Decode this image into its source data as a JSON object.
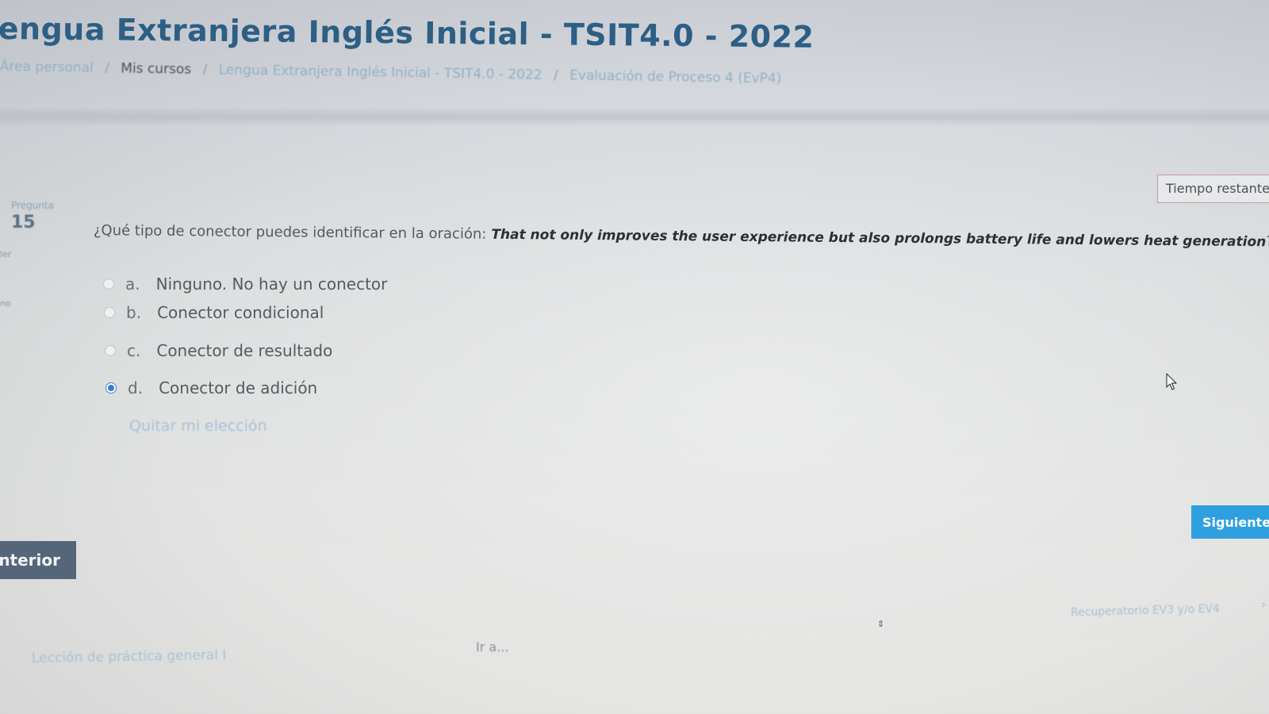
{
  "header": {
    "title": "engua Extranjera Inglés Inicial - TSIT4.0 - 2022",
    "breadcrumb": [
      {
        "label": "Área personal",
        "current": false
      },
      {
        "label": "Mis cursos",
        "current": true
      },
      {
        "label": "Lengua Extranjera Inglés Inicial - TSIT4.0 - 2022",
        "current": false
      },
      {
        "label": "Evaluación de Proceso 4 (EvP4)",
        "current": false
      }
    ],
    "separator": "/"
  },
  "timer": {
    "label": "Tiempo restante"
  },
  "question_info": {
    "label": "Pregunta",
    "number": "15",
    "fragment_1": "ler",
    "fragment_2": "no"
  },
  "question": {
    "prompt": "¿Qué tipo de conector puedes identificar en la oración:",
    "sentence": "That not only improves the user experience but also prolongs battery life and lowers heat generation",
    "end": "?"
  },
  "answers": [
    {
      "letter": "a.",
      "text": "Ninguno. No hay un conector",
      "selected": false
    },
    {
      "letter": "b.",
      "text": "Conector condicional",
      "selected": false
    },
    {
      "letter": "c.",
      "text": "Conector de resultado",
      "selected": false
    },
    {
      "letter": "d.",
      "text": "Conector de adición",
      "selected": true
    }
  ],
  "clear_choice": "Quitar mi elección",
  "buttons": {
    "previous": "nterior",
    "next": "Siguiente p"
  },
  "footer_nav": {
    "previous_activity": "Lección de práctica general I",
    "jump_to": "Ir a...",
    "jump_arrows": "⇕",
    "next_activity": "Recuperatorio EV3 y/o EV4",
    "next_chevron": "›"
  },
  "colors": {
    "title": "#2d5f85",
    "link": "#8fb1c8",
    "prev_button": "#56667a",
    "next_button": "#2ea0e0",
    "radio_selected": "#2f7fd6"
  },
  "icons": {
    "cursor": "mouse-pointer-icon",
    "next_activity": "chevron-right-icon"
  }
}
